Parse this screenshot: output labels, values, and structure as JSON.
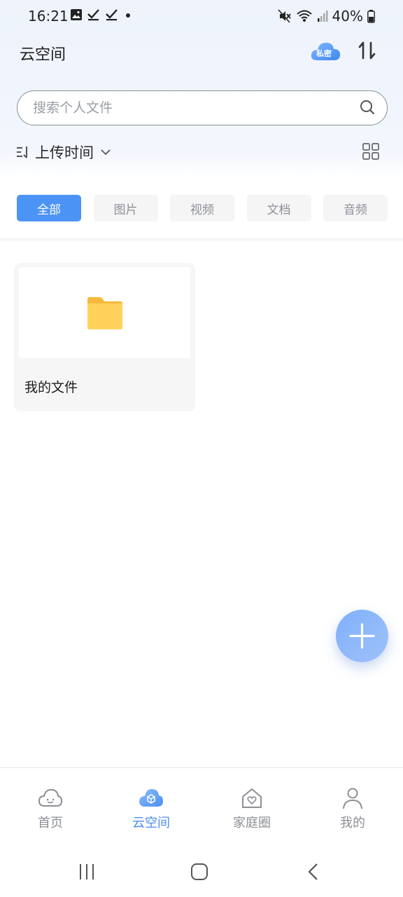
{
  "status_bar": {
    "time": "16:21",
    "battery": "40%"
  },
  "header": {
    "title": "云空间",
    "private_badge": "私密"
  },
  "search": {
    "placeholder": "搜索个人文件",
    "value": ""
  },
  "sort": {
    "label": "上传时间"
  },
  "filters": [
    {
      "label": "全部",
      "active": true
    },
    {
      "label": "图片",
      "active": false
    },
    {
      "label": "视频",
      "active": false
    },
    {
      "label": "文档",
      "active": false
    },
    {
      "label": "音频",
      "active": false
    }
  ],
  "files": [
    {
      "name": "我的文件",
      "type": "folder",
      "icon": "folder-icon"
    }
  ],
  "bottom_nav": [
    {
      "label": "首页",
      "icon": "home-cloud-icon",
      "active": false
    },
    {
      "label": "云空间",
      "icon": "cloud-space-icon",
      "active": true
    },
    {
      "label": "家庭圈",
      "icon": "family-home-icon",
      "active": false
    },
    {
      "label": "我的",
      "icon": "profile-icon",
      "active": false
    }
  ],
  "colors": {
    "accent": "#4c93f6",
    "folder": "#ffcd5a",
    "inactive_text": "#8c8f95"
  }
}
